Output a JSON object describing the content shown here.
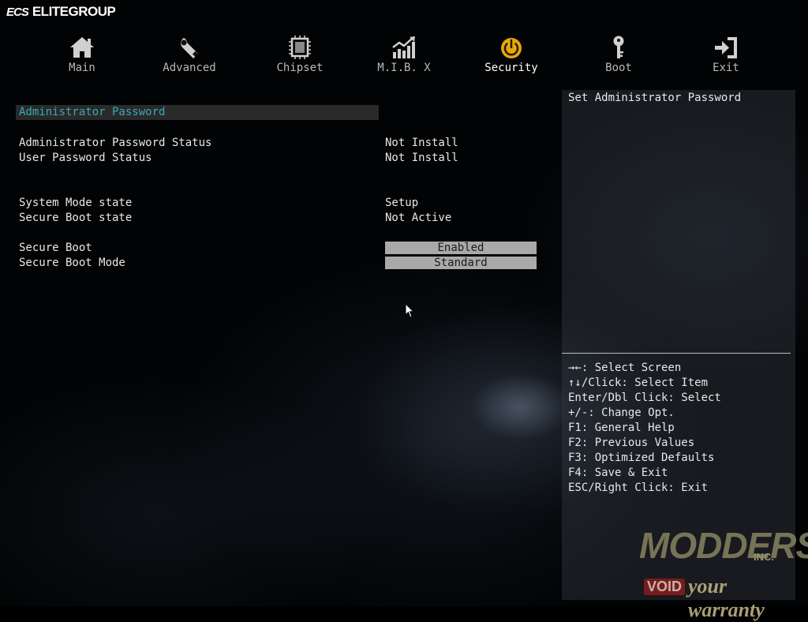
{
  "header": {
    "logo_mark": "ECS",
    "brand": "ELITEGROUP"
  },
  "tabs": [
    {
      "label": "Main",
      "icon": "house-icon",
      "active": false
    },
    {
      "label": "Advanced",
      "icon": "wrench-icon",
      "active": false
    },
    {
      "label": "Chipset",
      "icon": "chip-icon",
      "active": false
    },
    {
      "label": "M.I.B. X",
      "icon": "chart-icon",
      "active": false
    },
    {
      "label": "Security",
      "icon": "power-icon",
      "active": true
    },
    {
      "label": "Boot",
      "icon": "key-icon",
      "active": false
    },
    {
      "label": "Exit",
      "icon": "exit-door-icon",
      "active": false
    }
  ],
  "main": {
    "selected_item": "Administrator Password",
    "rows": [
      {
        "label": "Administrator Password Status",
        "value": "Not Install"
      },
      {
        "label": "User Password Status",
        "value": "Not Install"
      },
      {
        "label": "System Mode state",
        "value": "Setup"
      },
      {
        "label": "Secure Boot state",
        "value": "Not Active"
      }
    ],
    "options": [
      {
        "label": "Secure Boot",
        "value": "Enabled"
      },
      {
        "label": "Secure Boot Mode",
        "value": "Standard"
      }
    ]
  },
  "help": {
    "description": "Set Administrator Password",
    "keys": [
      "→←: Select Screen",
      "↑↓/Click: Select Item",
      "Enter/Dbl Click: Select",
      "+/-: Change Opt.",
      "F1: General Help",
      "F2: Previous Values",
      "F3: Optimized Defaults",
      "F4: Save & Exit",
      "ESC/Right Click: Exit"
    ]
  },
  "watermark": {
    "line1": "MODDERS",
    "inc": "INC.",
    "void": "VOID",
    "tagline": "your warranty"
  },
  "colors": {
    "accent_active": "#e8a800",
    "selected_text": "#3aa8b8",
    "option_box": "#a9a9a9",
    "icon_color": "#d0d0d0"
  }
}
